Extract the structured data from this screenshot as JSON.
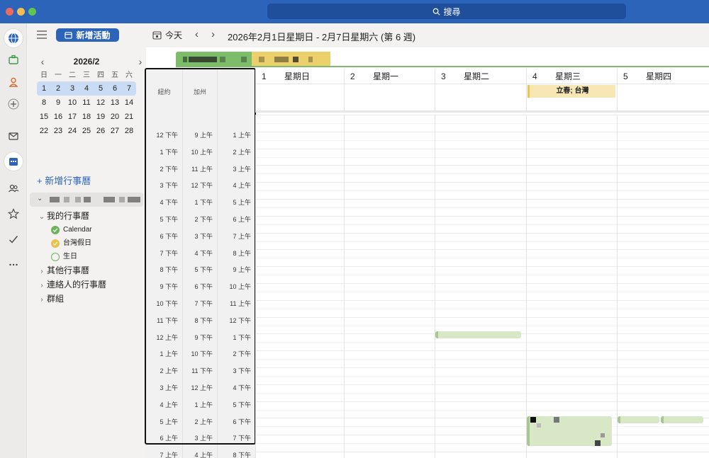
{
  "search": {
    "label": "搜尋"
  },
  "sidebar": {
    "new_event_label": "新增活動",
    "mini_calendar": {
      "title": "2026/2",
      "weekday_headers": [
        "日",
        "一",
        "二",
        "三",
        "四",
        "五",
        "六"
      ],
      "weeks": [
        [
          "1",
          "2",
          "3",
          "4",
          "5",
          "6",
          "7"
        ],
        [
          "8",
          "9",
          "10",
          "11",
          "12",
          "13",
          "14"
        ],
        [
          "15",
          "16",
          "17",
          "18",
          "19",
          "20",
          "21"
        ],
        [
          "22",
          "23",
          "24",
          "25",
          "26",
          "27",
          "28"
        ]
      ]
    },
    "add_calendar_label": "新增行事曆",
    "my_calendars_label": "我的行事曆",
    "calendars": [
      {
        "name": "Calendar",
        "color": "#6cb35c"
      },
      {
        "name": "台灣假日",
        "color": "#e6c34b"
      },
      {
        "name": "生日",
        "color": "#6cb35c"
      }
    ],
    "other_calendars_label": "其他行事曆",
    "contacts_calendars_label": "連絡人的行事曆",
    "groups_label": "群組"
  },
  "toolbar": {
    "today_label": "今天",
    "date_range": "2026年2月1日星期日 - 2月7日星期六 (第 6 週)"
  },
  "timezones": {
    "headers": [
      "紐約",
      "加州",
      ""
    ],
    "rows": [
      [
        "12 下午",
        "9 上午",
        "1 上午"
      ],
      [
        "1 下午",
        "10 上午",
        "2 上午"
      ],
      [
        "2 下午",
        "11 上午",
        "3 上午"
      ],
      [
        "3 下午",
        "12 下午",
        "4 上午"
      ],
      [
        "4 下午",
        "1 下午",
        "5 上午"
      ],
      [
        "5 下午",
        "2 下午",
        "6 上午"
      ],
      [
        "6 下午",
        "3 下午",
        "7 上午"
      ],
      [
        "7 下午",
        "4 下午",
        "8 上午"
      ],
      [
        "8 下午",
        "5 下午",
        "9 上午"
      ],
      [
        "9 下午",
        "6 下午",
        "10 上午"
      ],
      [
        "10 下午",
        "7 下午",
        "11 上午"
      ],
      [
        "11 下午",
        "8 下午",
        "12 下午"
      ],
      [
        "12 上午",
        "9 下午",
        "1 下午"
      ],
      [
        "1 上午",
        "10 下午",
        "2 下午"
      ],
      [
        "2 上午",
        "11 下午",
        "3 下午"
      ],
      [
        "3 上午",
        "12 上午",
        "4 下午"
      ],
      [
        "4 上午",
        "1 上午",
        "5 下午"
      ],
      [
        "5 上午",
        "2 上午",
        "6 下午"
      ],
      [
        "6 上午",
        "3 上午",
        "7 下午"
      ],
      [
        "7 上午",
        "4 上午",
        "8 下午"
      ]
    ]
  },
  "days": [
    {
      "num": "1",
      "name": "星期日"
    },
    {
      "num": "2",
      "name": "星期一"
    },
    {
      "num": "3",
      "name": "星期二"
    },
    {
      "num": "4",
      "name": "星期三"
    },
    {
      "num": "5",
      "name": "星期四"
    }
  ],
  "allday_event": {
    "title": "立春; 台灣"
  }
}
